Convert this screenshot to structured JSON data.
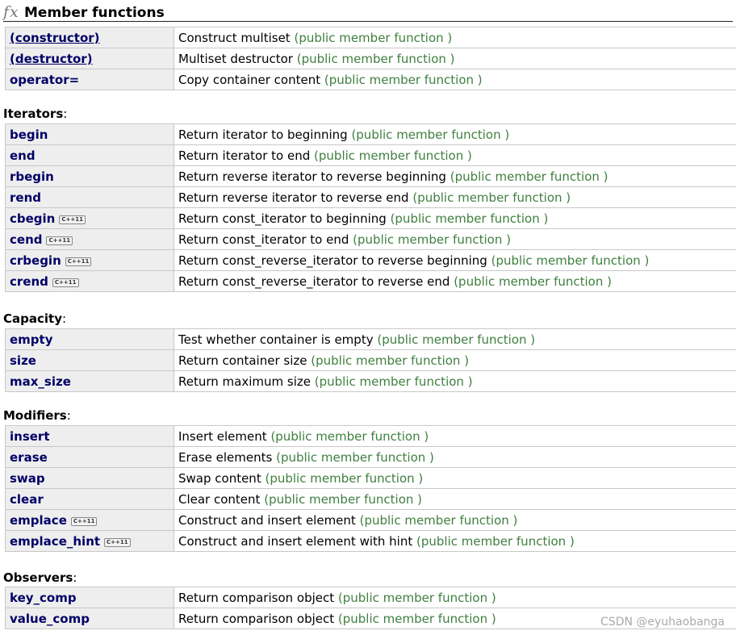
{
  "header": {
    "icon": "fx",
    "title": "Member functions"
  },
  "tag": "(public member function )",
  "badge": "C++11",
  "sections": {
    "main": {
      "rows": [
        {
          "name": "(constructor)",
          "desc": "Construct multiset"
        },
        {
          "name": "(destructor)",
          "desc": "Multiset destructor"
        },
        {
          "name": "operator=",
          "desc": "Copy container content"
        }
      ]
    },
    "iterators": {
      "label": "Iterators",
      "rows": [
        {
          "name": "begin",
          "desc": "Return iterator to beginning"
        },
        {
          "name": "end",
          "desc": "Return iterator to end"
        },
        {
          "name": "rbegin",
          "desc": "Return reverse iterator to reverse beginning"
        },
        {
          "name": "rend",
          "desc": "Return reverse iterator to reverse end"
        },
        {
          "name": "cbegin",
          "desc": "Return const_iterator to beginning"
        },
        {
          "name": "cend",
          "desc": "Return const_iterator to end"
        },
        {
          "name": "crbegin",
          "desc": "Return const_reverse_iterator to reverse beginning"
        },
        {
          "name": "crend",
          "desc": "Return const_reverse_iterator to reverse end"
        }
      ]
    },
    "capacity": {
      "label": "Capacity",
      "rows": [
        {
          "name": "empty",
          "desc": "Test whether container is empty"
        },
        {
          "name": "size",
          "desc": "Return container size"
        },
        {
          "name": "max_size",
          "desc": "Return maximum size"
        }
      ]
    },
    "modifiers": {
      "label": "Modifiers",
      "rows": [
        {
          "name": "insert",
          "desc": "Insert element"
        },
        {
          "name": "erase",
          "desc": "Erase elements"
        },
        {
          "name": "swap",
          "desc": "Swap content"
        },
        {
          "name": "clear",
          "desc": "Clear content"
        },
        {
          "name": "emplace",
          "desc": "Construct and insert element"
        },
        {
          "name": "emplace_hint",
          "desc": "Construct and insert element with hint"
        }
      ]
    },
    "observers": {
      "label": "Observers",
      "rows": [
        {
          "name": "key_comp",
          "desc": "Return comparison object"
        },
        {
          "name": "value_comp",
          "desc": "Return comparison object"
        }
      ]
    }
  },
  "watermark": "CSDN @eyuhaobanga",
  "colors": {
    "name_text": "#000066",
    "tag_text": "#3f7f3f",
    "name_bg": "#eeeeee",
    "border": "#c8c8c8"
  }
}
